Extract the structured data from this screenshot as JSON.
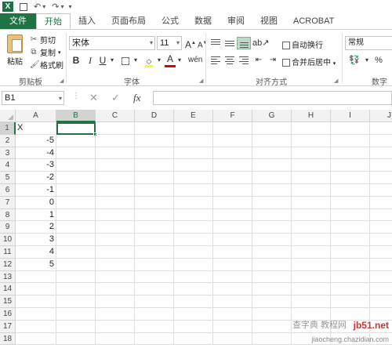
{
  "qat": {
    "logo": "X",
    "undo": "↶",
    "redo": "↷",
    "more": "▾"
  },
  "tabs": [
    {
      "label": "文件"
    },
    {
      "label": "开始"
    },
    {
      "label": "插入"
    },
    {
      "label": "页面布局"
    },
    {
      "label": "公式"
    },
    {
      "label": "数据"
    },
    {
      "label": "审阅"
    },
    {
      "label": "视图"
    },
    {
      "label": "ACROBAT"
    }
  ],
  "ribbon": {
    "clipboard": {
      "paste": "粘贴",
      "cut": "剪切",
      "copy": "复制",
      "format_painter": "格式刷",
      "group": "剪贴板"
    },
    "font": {
      "name": "宋体",
      "size": "11",
      "bold": "B",
      "italic": "I",
      "underline": "U",
      "group": "字体",
      "grow": "A",
      "shrink": "A"
    },
    "alignment": {
      "wrap_text": "自动换行",
      "merge_center": "合并后居中",
      "group": "对齐方式"
    },
    "number": {
      "format": "常规",
      "group": "数字"
    }
  },
  "formula_bar": {
    "name_box": "B1",
    "fx": "fx",
    "value": ""
  },
  "grid": {
    "columns": [
      "A",
      "B",
      "C",
      "D",
      "E",
      "F",
      "G",
      "H",
      "I",
      "J"
    ],
    "rows": [
      "1",
      "2",
      "3",
      "4",
      "5",
      "6",
      "7",
      "8",
      "9",
      "10",
      "11",
      "12",
      "13",
      "14",
      "15",
      "16",
      "17",
      "18"
    ],
    "col_a_values": [
      "X",
      "-5",
      "-4",
      "-3",
      "-2",
      "-1",
      "0",
      "1",
      "2",
      "3",
      "4",
      "5"
    ],
    "selected_cell": "B1"
  },
  "watermark": {
    "line1": "查字典 教程网",
    "site": "jb51.net",
    "line2": "jiaocheng.chazidian.com"
  },
  "colors": {
    "accent": "#217346"
  }
}
